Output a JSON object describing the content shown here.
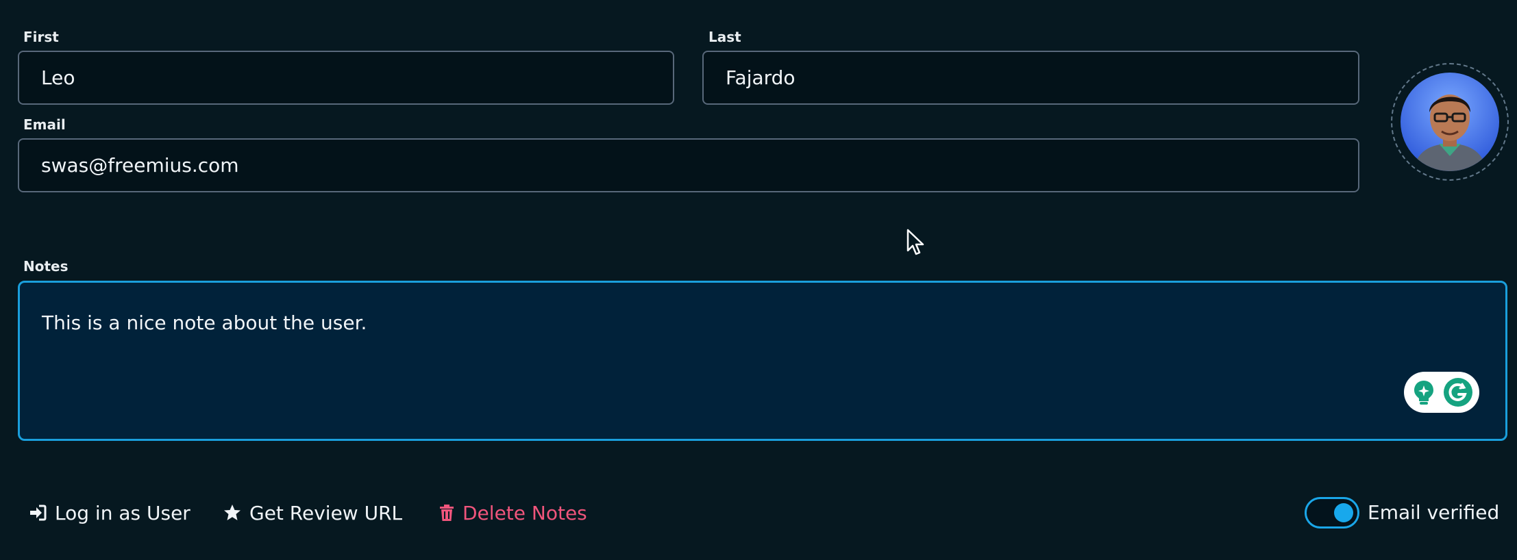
{
  "form": {
    "first": {
      "label": "First",
      "value": "Leo"
    },
    "last": {
      "label": "Last",
      "value": "Fajardo"
    },
    "email": {
      "label": "Email",
      "value": "swas@freemius.com"
    },
    "notes": {
      "label": "Notes",
      "value": "This is a nice note about the user."
    }
  },
  "avatar": {
    "icon": "user-photo"
  },
  "grammarly": {
    "bulb_icon": "lightbulb-icon",
    "logo_icon": "grammarly-g-icon"
  },
  "actions": {
    "login_as_user": {
      "label": "Log in as User",
      "icon": "sign-in-icon"
    },
    "get_review_url": {
      "label": "Get Review URL",
      "icon": "star-icon"
    },
    "delete_notes": {
      "label": "Delete Notes",
      "icon": "trash-icon"
    }
  },
  "email_verified": {
    "label": "Email verified",
    "on": true
  },
  "colors": {
    "background": "#061820",
    "accent": "#1aa6e8",
    "danger": "#f0557c",
    "notes_bg": "#01223a"
  }
}
